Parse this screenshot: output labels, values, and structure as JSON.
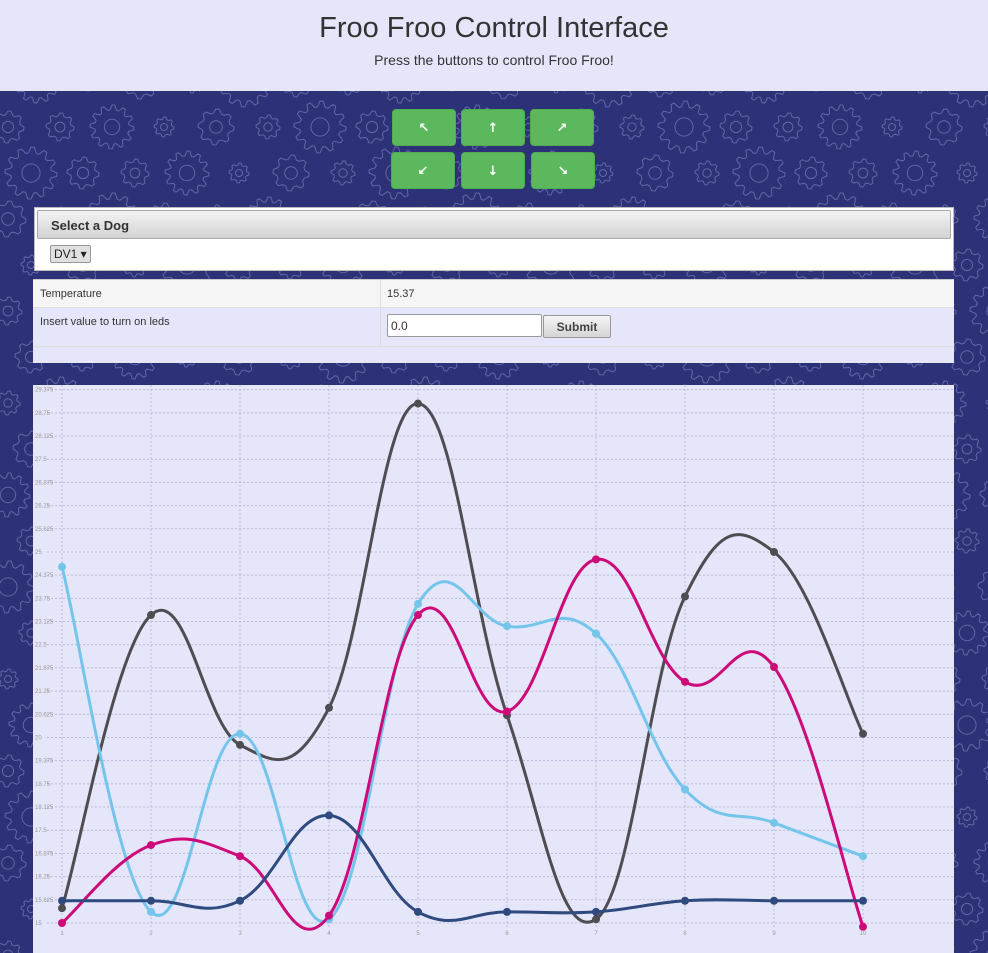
{
  "header": {
    "title": "Froo Froo Control Interface",
    "subtitle": "Press the buttons to control Froo Froo!"
  },
  "controls": {
    "buttons": [
      {
        "name": "up-left",
        "glyph": "↖"
      },
      {
        "name": "up",
        "glyph": "↑"
      },
      {
        "name": "up-right",
        "glyph": "↗"
      },
      {
        "name": "down-left",
        "glyph": "↙"
      },
      {
        "name": "down",
        "glyph": "↓"
      },
      {
        "name": "down-right",
        "glyph": "↘"
      }
    ],
    "color": "#5cb85c"
  },
  "dog_panel": {
    "title": "Select a Dog",
    "selected": "DV1 ▾"
  },
  "table": {
    "temperature_label": "Temperature",
    "temperature_value": "15.37",
    "led_label": "Insert value to turn on leds",
    "led_input_value": "0.0",
    "submit_label": "Submit"
  },
  "background": {
    "color": "#2c3178",
    "pattern_icon": "gear-icon"
  },
  "chart_data": {
    "type": "line",
    "x": [
      1,
      2,
      3,
      4,
      5,
      6,
      7,
      8,
      9,
      10
    ],
    "ylim": [
      15,
      29.5
    ],
    "y_ticks": [
      "15",
      "15.625",
      "16.25",
      "16.875",
      "17.5",
      "18.125",
      "18.75",
      "19.375",
      "20",
      "20.625",
      "21.25",
      "21.875",
      "22.5",
      "23.125",
      "23.75",
      "24.375",
      "25",
      "25.625",
      "26.25",
      "26.875",
      "27.5",
      "28.125",
      "28.75",
      "29.375"
    ],
    "x_ticks": [
      "1",
      "2",
      "3",
      "4",
      "5",
      "6",
      "7",
      "8",
      "9",
      "10"
    ],
    "grid": true,
    "series": [
      {
        "color": "#4d4d52",
        "values": [
          15.4,
          23.3,
          19.8,
          20.8,
          29.0,
          20.6,
          15.1,
          23.8,
          25.0,
          20.1
        ]
      },
      {
        "color": "#74c5ec",
        "values": [
          24.6,
          15.3,
          20.1,
          15.1,
          23.6,
          23.0,
          22.8,
          18.6,
          17.7,
          16.8
        ]
      },
      {
        "color": "#cc0a7a",
        "values": [
          15.0,
          17.1,
          16.8,
          15.2,
          23.3,
          20.7,
          24.8,
          21.5,
          21.9,
          14.9
        ]
      },
      {
        "color": "#2e4a7e",
        "values": [
          15.6,
          15.6,
          15.6,
          17.9,
          15.3,
          15.3,
          15.3,
          15.6,
          15.6,
          15.6
        ]
      }
    ]
  }
}
